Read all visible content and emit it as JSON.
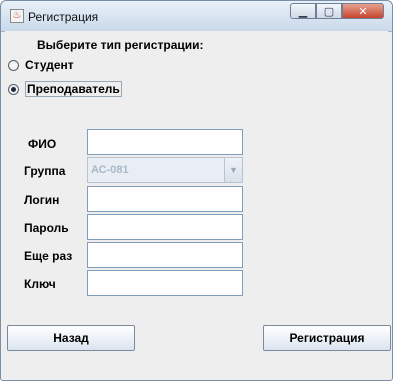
{
  "window": {
    "title": "Регистрация",
    "app_icon": "java-cup-icon",
    "controls": [
      "minimize",
      "maximize",
      "close"
    ]
  },
  "form": {
    "hint": "Выберите тип регистрации:",
    "radios": [
      {
        "label": "Студент",
        "checked": false
      },
      {
        "label": "Преподаватель",
        "checked": true
      }
    ],
    "labels": {
      "fio": "ФИО",
      "group": "Группа",
      "login": "Логин",
      "password": "Пароль",
      "password_again": "Еще раз",
      "key": "Ключ"
    },
    "values": {
      "fio": "",
      "group": "АС-081",
      "login": "",
      "password": "",
      "password_again": "",
      "key": ""
    }
  },
  "buttons": {
    "back": "Назад",
    "register": "Регистрация"
  }
}
